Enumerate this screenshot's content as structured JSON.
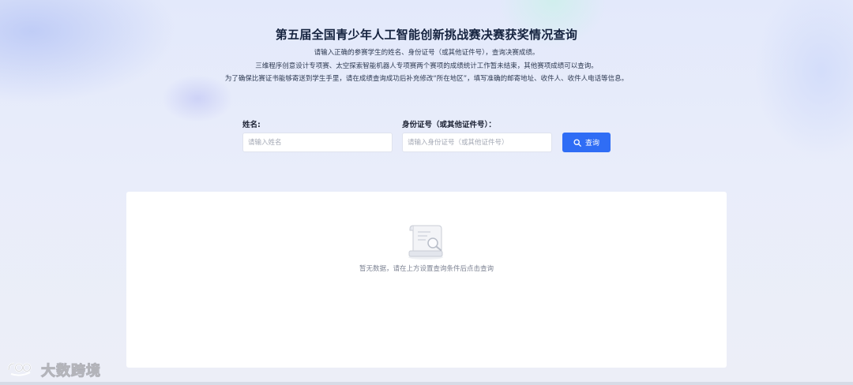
{
  "header": {
    "title": "第五届全国青少年人工智能创新挑战赛决赛获奖情况查询",
    "description_lines": [
      "请输入正确的参赛学生的姓名、身份证号（或其他证件号），查询决赛成绩。",
      "三维程序创意设计专项赛、太空探索智能机器人专项赛两个赛项的成绩统计工作暂未结束，其他赛项成绩可以查询。",
      "为了确保比赛证书能够寄送到学生手里，请在成绩查询成功后补充修改“所在地区”，填写准确的邮寄地址、收件人、收件人电话等信息。"
    ]
  },
  "form": {
    "name_label": "姓名:",
    "name_placeholder": "请输入姓名",
    "id_label": "身份证号（或其他证件号）：",
    "id_placeholder": "请输入身份证号（或其他证件号）",
    "search_label": "查询",
    "search_icon": "search-icon",
    "accent_color": "#2f6df5"
  },
  "results": {
    "empty_icon": "document-magnifier-icon",
    "empty_text": "暂无数据，请在上方设置查询条件后点击查询"
  },
  "watermark": {
    "logo_icon": "brand-logo-icon",
    "text": "大数跨境"
  }
}
